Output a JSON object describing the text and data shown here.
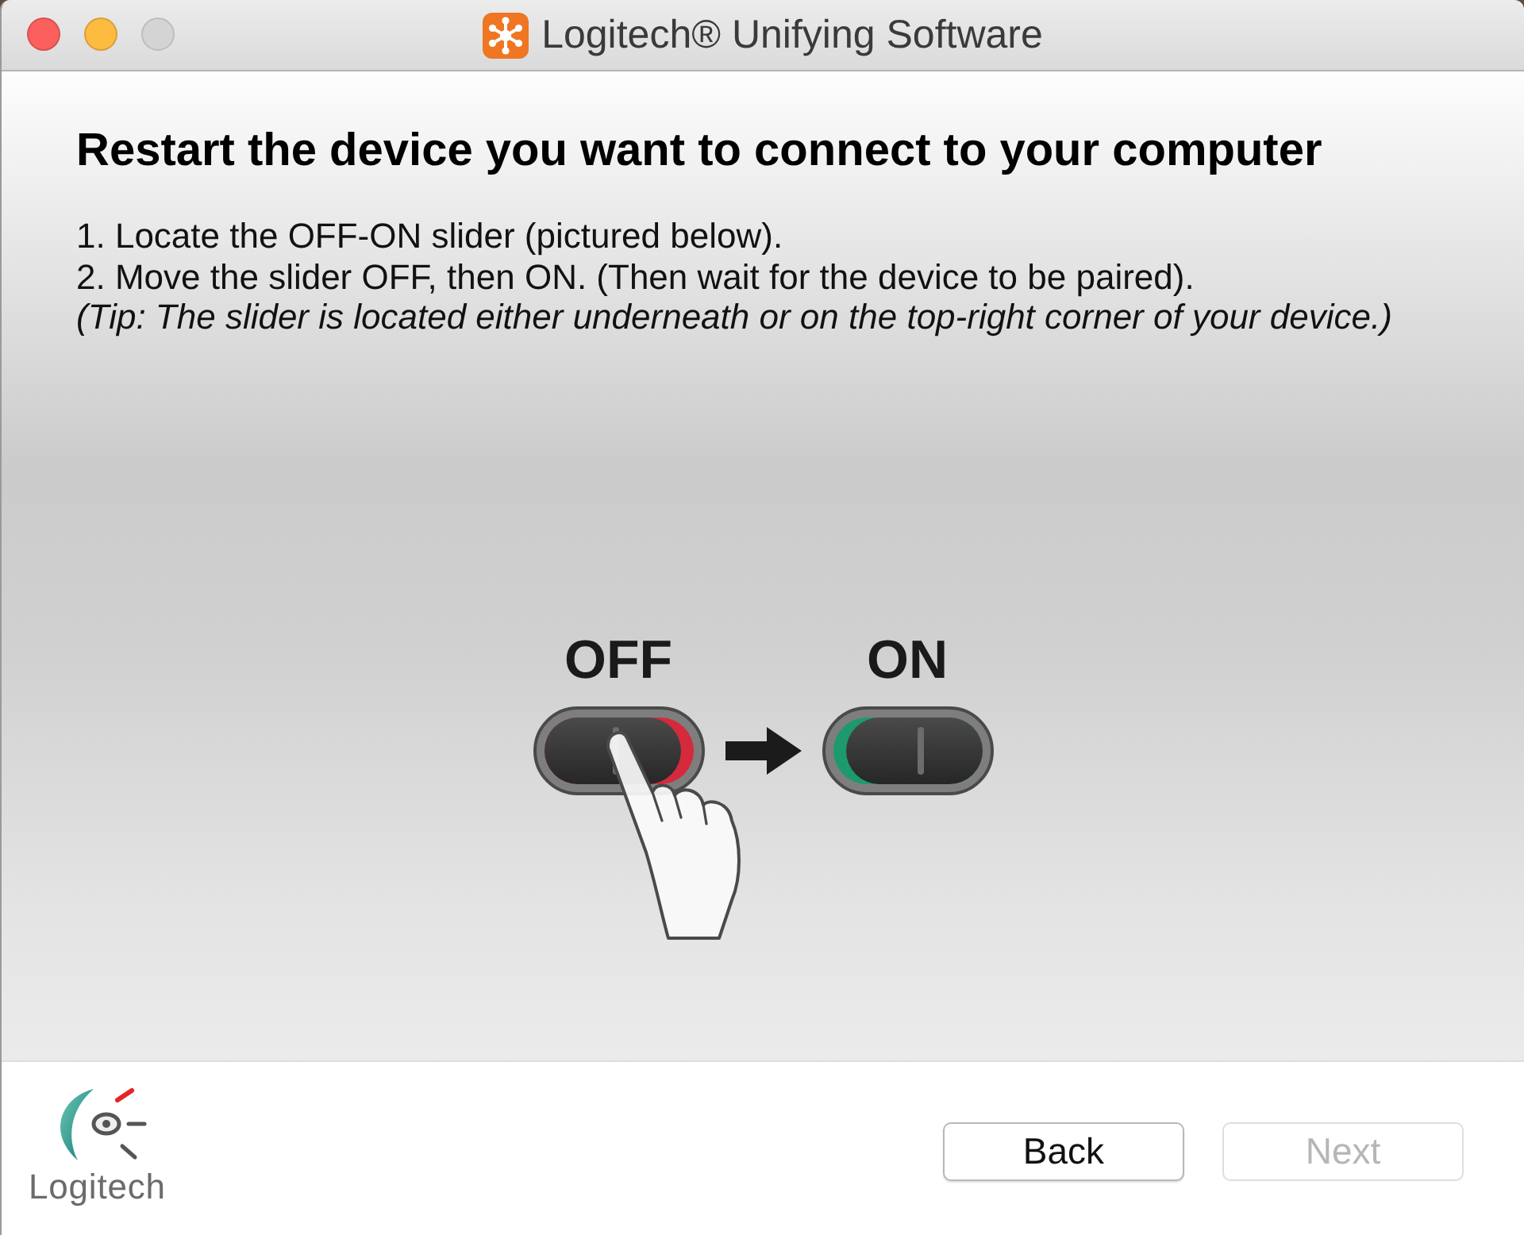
{
  "window": {
    "title": "Logitech® Unifying Software",
    "buttons": [
      {
        "kind": "close",
        "disabled": false
      },
      {
        "kind": "minimize",
        "disabled": false
      },
      {
        "kind": "zoom",
        "disabled": true
      }
    ]
  },
  "heading": "Restart the device you want to connect to your computer",
  "instructions": [
    {
      "kind": "step",
      "text": "1. Locate the OFF-ON slider (pictured below)."
    },
    {
      "kind": "step",
      "text": "2. Move the slider OFF, then ON. (Then wait for the device to be paired)."
    },
    {
      "kind": "tip",
      "text": "(Tip: The slider is located either underneath or on the top-right corner of your device.)"
    }
  ],
  "illustration": {
    "switches": [
      {
        "label": "OFF",
        "on": false
      },
      {
        "label": "ON",
        "on": true
      }
    ]
  },
  "logo": {
    "wordmark": "Logitech"
  },
  "buttons": [
    {
      "label": "Back",
      "disabled": false
    },
    {
      "label": "Next",
      "disabled": true
    }
  ]
}
